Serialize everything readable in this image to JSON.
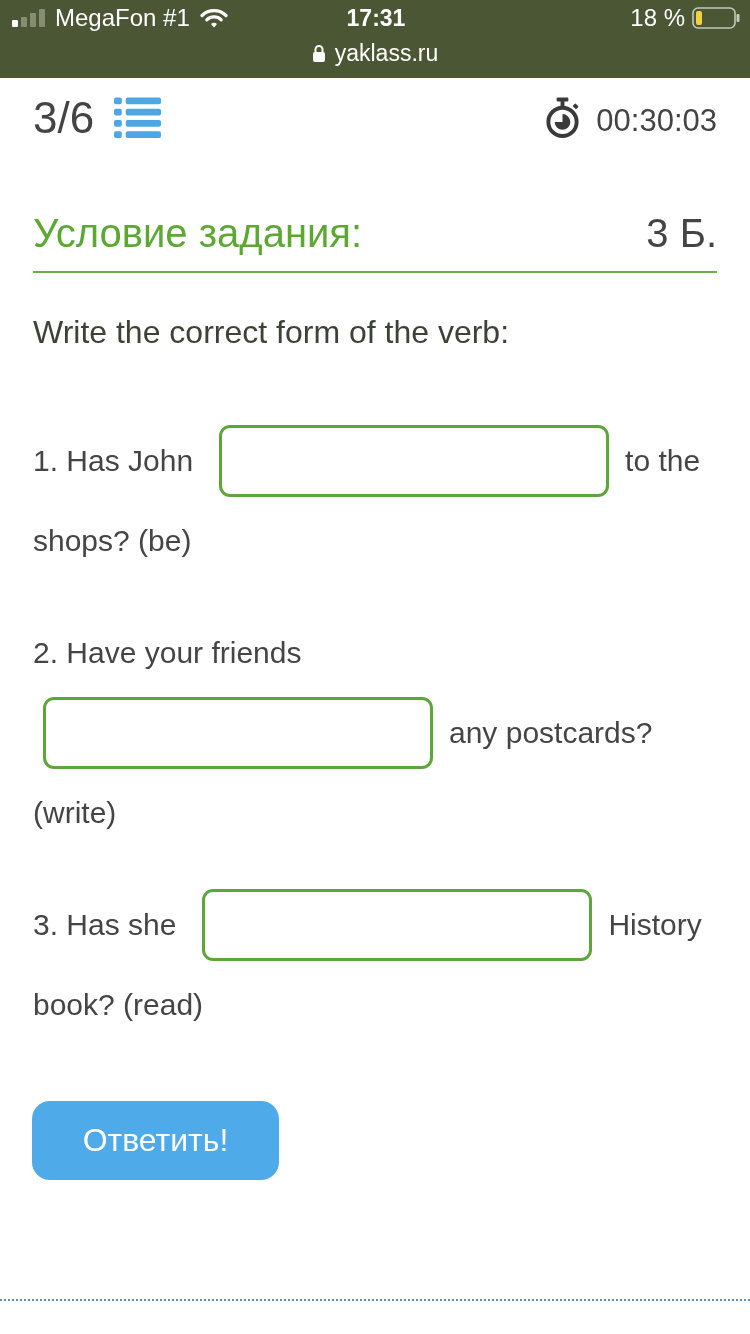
{
  "status_bar": {
    "carrier": "MegaFon #1",
    "time": "17:31",
    "battery": "18 %",
    "url": "yaklass.ru"
  },
  "header": {
    "progress": "3/6",
    "timer": "00:30:03"
  },
  "task": {
    "title": "Условие задания:",
    "points": "3 Б.",
    "instruction": "Write the correct form of the verb:"
  },
  "questions": [
    {
      "parts": [
        {
          "kind": "text",
          "text": "1. Has John"
        },
        {
          "kind": "blank"
        },
        {
          "kind": "text",
          "text": "to the"
        },
        {
          "kind": "text",
          "text": "shops? (be)"
        }
      ]
    },
    {
      "parts": [
        {
          "kind": "text",
          "text": "2. Have your friends"
        },
        {
          "kind": "blank"
        },
        {
          "kind": "text",
          "text": "any postcards?"
        },
        {
          "kind": "text",
          "text": "(write)"
        }
      ]
    },
    {
      "parts": [
        {
          "kind": "text",
          "text": "3. Has she"
        },
        {
          "kind": "blank"
        },
        {
          "kind": "text",
          "text": "History"
        },
        {
          "kind": "text",
          "text": "book? (read)"
        }
      ]
    }
  ],
  "button": {
    "label": "Ответить!"
  }
}
